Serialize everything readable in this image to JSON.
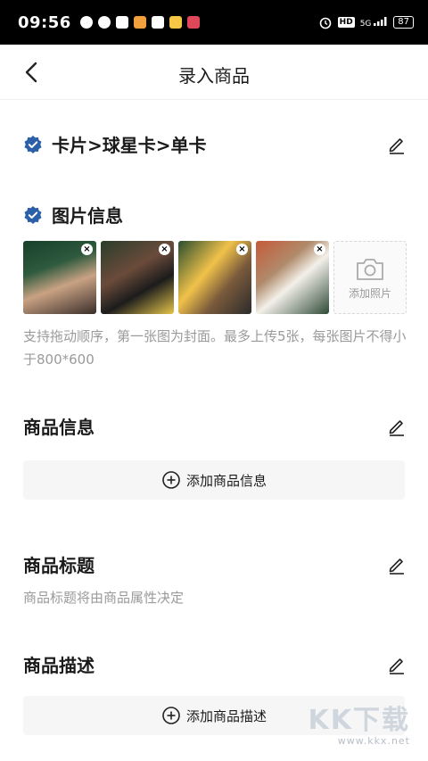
{
  "status_bar": {
    "time": "09:56",
    "network": "5G",
    "hd": "HD",
    "battery": "87"
  },
  "nav": {
    "title": "录入商品",
    "back_icon": "chevron-left-icon"
  },
  "category": {
    "path": "卡片>球星卡>单卡",
    "icon": "verified-check-icon",
    "edit_icon": "pencil-icon"
  },
  "images": {
    "title": "图片信息",
    "icon": "verified-check-icon",
    "photos": [
      {
        "delete_icon": "×",
        "colors": [
          "#1d5a3a",
          "#cfa88a",
          "#2d2d2d"
        ]
      },
      {
        "delete_icon": "×",
        "colors": [
          "#253a28",
          "#6b4a3a",
          "#e8c84a"
        ]
      },
      {
        "delete_icon": "×",
        "colors": [
          "#2a4a2e",
          "#f1c34a",
          "#7a5a3c"
        ]
      },
      {
        "delete_icon": "×",
        "colors": [
          "#c65a3a",
          "#a37a5a",
          "#334a39"
        ]
      }
    ],
    "add_label": "添加照片",
    "add_icon": "camera-icon",
    "hint": "支持拖动顺序，第一张图为封面。最多上传5张，每张图片不得小于800*600"
  },
  "product_info": {
    "title": "商品信息",
    "add_label": "添加商品信息",
    "add_icon": "plus-circle-icon",
    "edit_icon": "pencil-icon"
  },
  "product_title": {
    "title": "商品标题",
    "hint": "商品标题将由商品属性决定",
    "edit_icon": "pencil-icon"
  },
  "product_desc": {
    "title": "商品描述",
    "add_label": "添加商品描述",
    "add_icon": "plus-circle-icon",
    "edit_icon": "pencil-icon"
  },
  "watermark": {
    "brand": "KK下载",
    "url": "www.kkx.net"
  },
  "colors": {
    "accent": "#2b5fa8",
    "hint": "#9a9a9a",
    "bar_bg": "#f6f6f6"
  }
}
